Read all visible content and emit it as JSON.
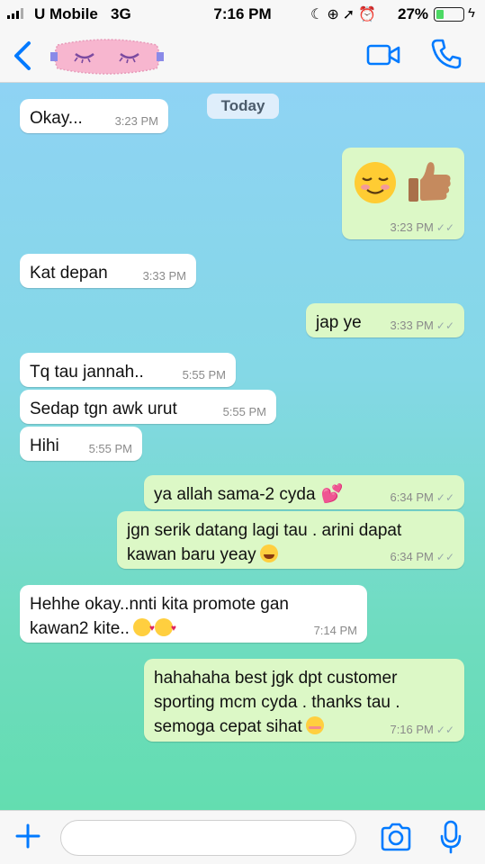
{
  "status_bar": {
    "carrier": "U Mobile",
    "network": "3G",
    "time": "7:16 PM",
    "battery_percent": "27%",
    "battery_level": 0.27,
    "icons": [
      "moon-icon",
      "lock-rotation-icon",
      "location-icon",
      "alarm-icon"
    ]
  },
  "nav": {
    "back_icon": "chevron-left-icon",
    "avatar": "sleep-mask-avatar",
    "video_icon": "video-camera-icon",
    "call_icon": "phone-icon"
  },
  "chat": {
    "date_label": "Today",
    "messages": [
      {
        "direction": "in",
        "text": "Okay...",
        "time": "3:23 PM"
      },
      {
        "direction": "out",
        "text": "",
        "emojis": [
          "relieved-face",
          "thumbs-up"
        ],
        "time": "3:23 PM"
      },
      {
        "direction": "in",
        "text": "Kat depan",
        "time": "3:33 PM"
      },
      {
        "direction": "out",
        "text": "jap ye",
        "time": "3:33 PM"
      },
      {
        "direction": "in",
        "text": "Tq tau jannah..",
        "time": "5:55 PM"
      },
      {
        "direction": "in",
        "text": "Sedap tgn awk urut",
        "time": "5:55 PM"
      },
      {
        "direction": "in",
        "text": "Hihi",
        "time": "5:55 PM"
      },
      {
        "direction": "out",
        "text": "ya allah sama-2 cyda",
        "emojis": [
          "two-hearts"
        ],
        "time": "6:34 PM"
      },
      {
        "direction": "out",
        "lines": [
          "jgn serik datang lagi tau . arini dapat",
          "kawan baru yeay"
        ],
        "emojis": [
          "tears-of-joy"
        ],
        "time": "6:34 PM"
      },
      {
        "direction": "in",
        "lines": [
          "Hehhe okay..nnti kita promote gan",
          "kawan2 kite.."
        ],
        "emojis": [
          "kiss-face",
          "kiss-face"
        ],
        "time": "7:14 PM"
      },
      {
        "direction": "out",
        "lines": [
          "hahahaha best jgk dpt customer",
          "sporting mcm cyda . thanks tau .",
          "semoga cepat sihat"
        ],
        "emojis": [
          "relieved-face"
        ],
        "time": "7:16 PM"
      }
    ]
  },
  "composer": {
    "placeholder": "",
    "value": "",
    "plus_icon": "plus-icon",
    "camera_icon": "camera-icon",
    "mic_icon": "microphone-icon"
  },
  "colors": {
    "accent": "#007aff",
    "bubble_out": "#dcf8c6",
    "bubble_in": "#ffffff",
    "bg_top": "#8fd3f4",
    "bg_bottom": "#63ddb0"
  }
}
